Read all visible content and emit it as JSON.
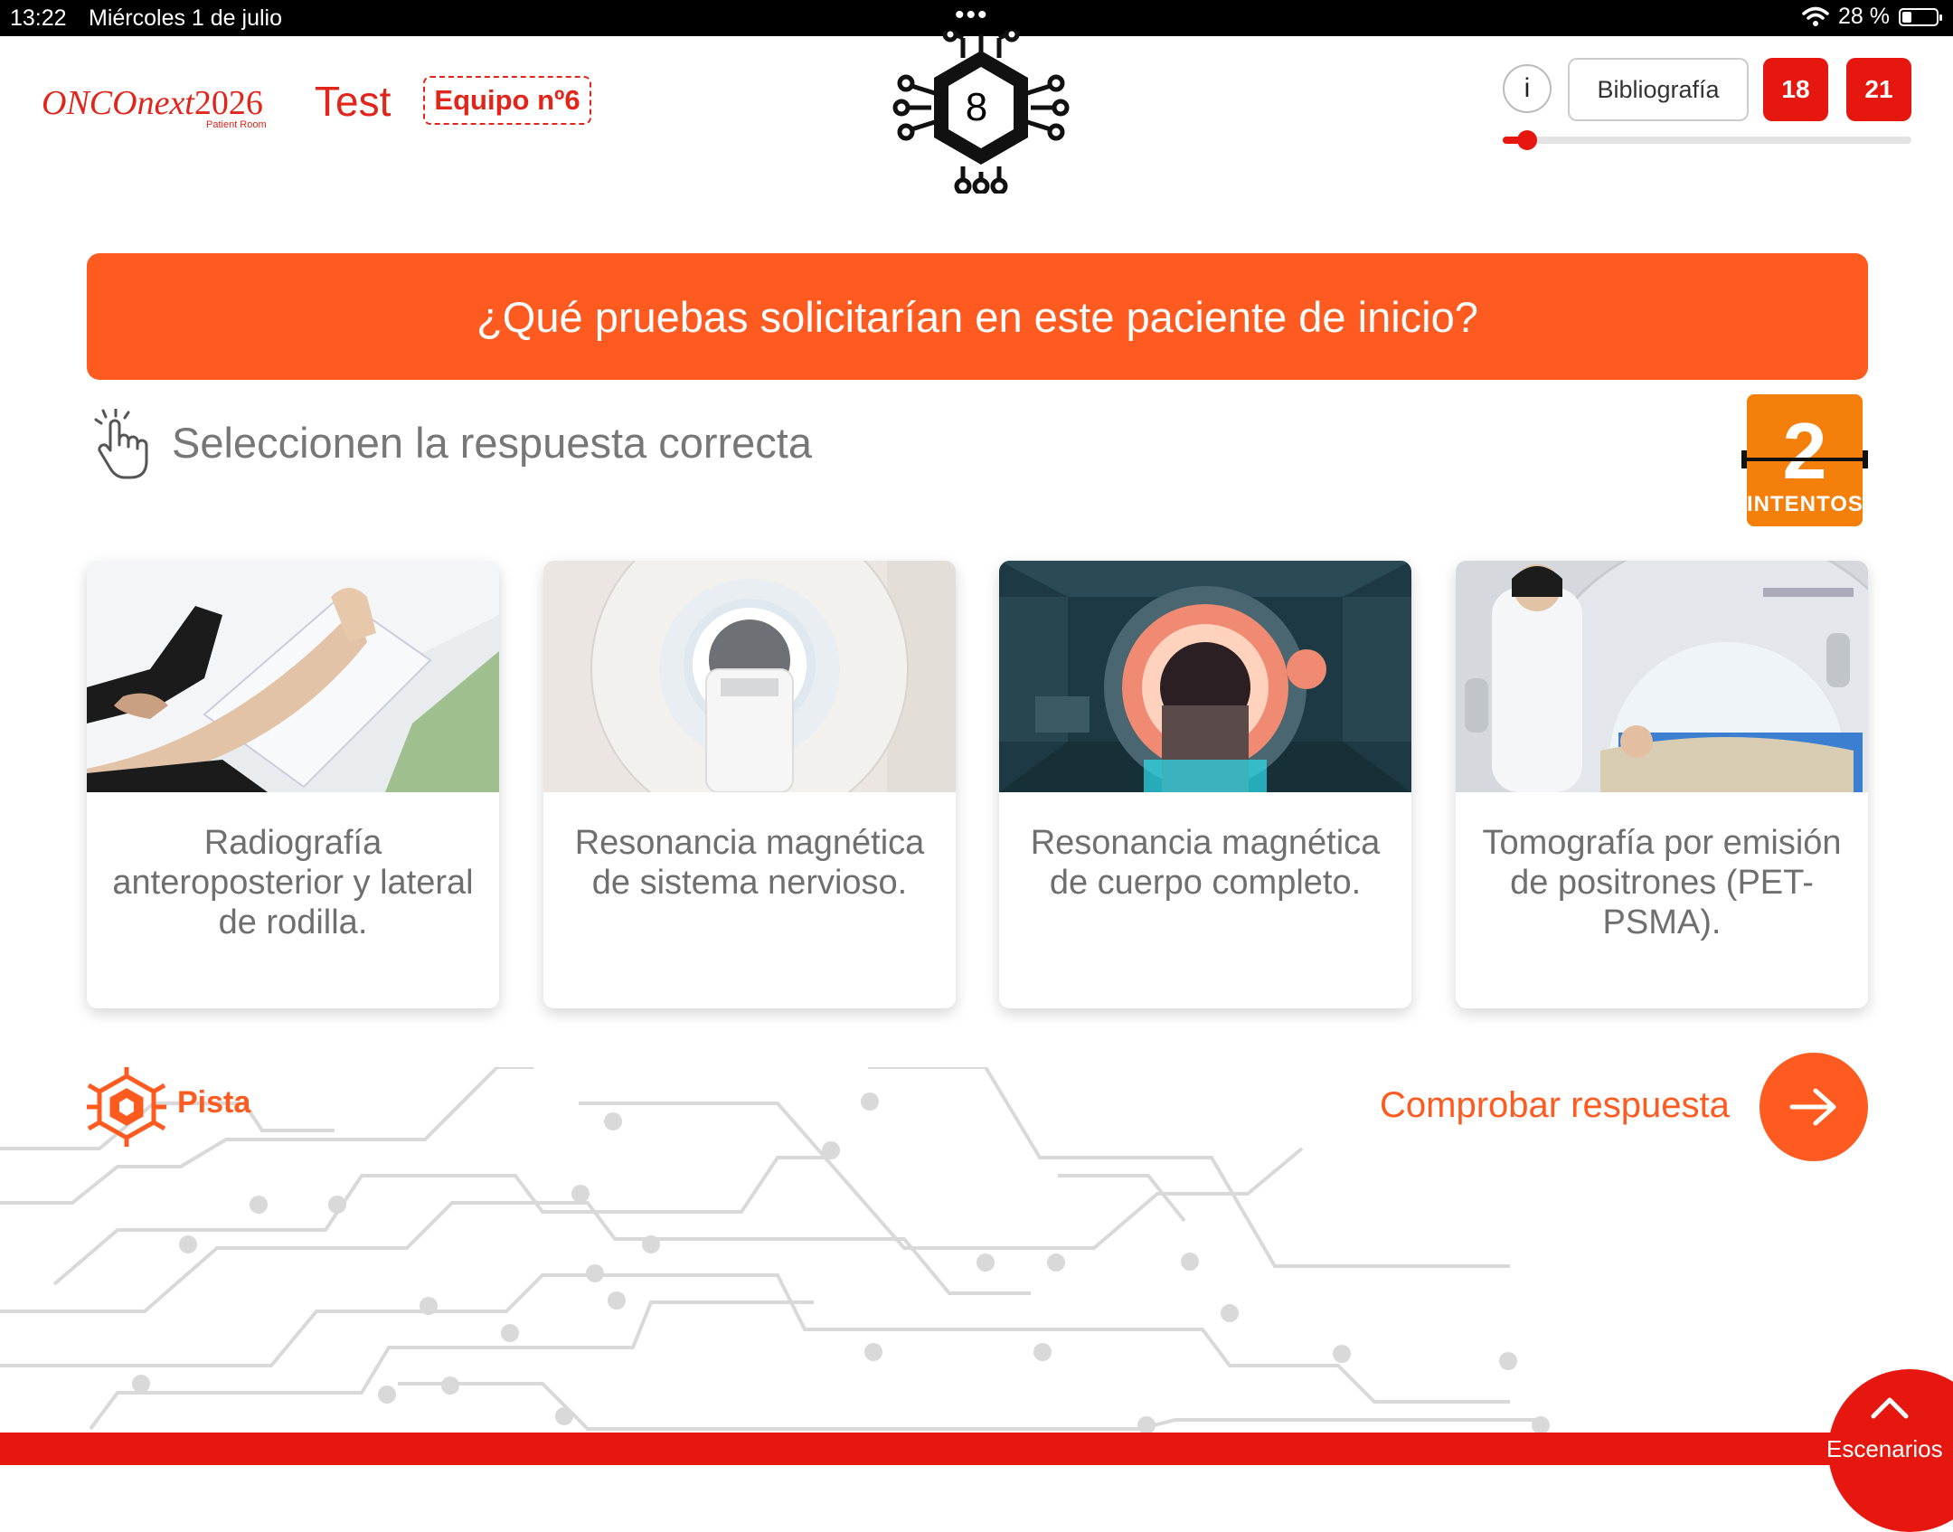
{
  "status_bar": {
    "time": "13:22",
    "date": "Miércoles 1 de julio",
    "multitask_dots": "•••",
    "battery_text": "28 %",
    "battery_level": 0.28
  },
  "header": {
    "logo_main": "ONCOnext",
    "logo_year": "2026",
    "logo_sub": "Patient Room",
    "mode": "Test",
    "team": "Equipo nº6",
    "level_number": "8",
    "info_label": "i",
    "bibliography_label": "Bibliografía",
    "counter_a": "18",
    "counter_b": "21",
    "progress": 0.06,
    "accent_color": "#e5170f"
  },
  "question": {
    "text": "¿Qué pruebas solicitarían en este paciente de inicio?",
    "color": "#ff5a1f"
  },
  "instruction": {
    "text": "Seleccionen la respuesta correcta",
    "icon": "tap-hand-icon"
  },
  "attempts": {
    "count": "2",
    "label": "INTENTOS",
    "color": "#f57f0b"
  },
  "options": [
    {
      "text": "Radiografía anteroposterior y lateral de rodilla.",
      "image": "knee-xray-photo"
    },
    {
      "text": "Resonancia magnética de sistema nervioso.",
      "image": "mri-scanner-photo"
    },
    {
      "text": "Resonancia magnética de cuerpo completo.",
      "image": "futuristic-mri-room-photo"
    },
    {
      "text": "Tomografía por emisión de positrones (PET-PSMA).",
      "image": "pet-scanner-photo"
    }
  ],
  "footer": {
    "hint_label": "Pista",
    "check_label": "Comprobar respuesta",
    "scenarios_label": "Escenarios"
  }
}
